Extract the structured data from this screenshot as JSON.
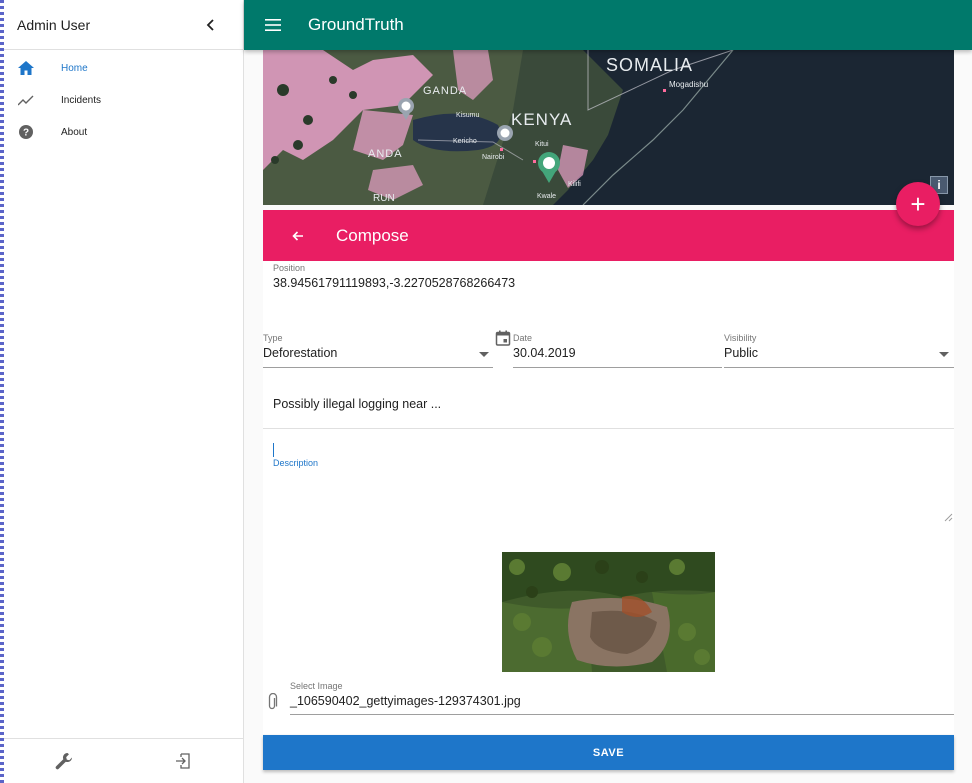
{
  "sidebar": {
    "user_name": "Admin User",
    "items": [
      {
        "label": "Home",
        "icon": "home-icon",
        "active": true
      },
      {
        "label": "Incidents",
        "icon": "trending-icon",
        "active": false
      },
      {
        "label": "About",
        "icon": "help-icon",
        "active": false
      }
    ]
  },
  "appbar": {
    "title": "GroundTruth"
  },
  "map": {
    "labels": {
      "somalia": "SOMALIA",
      "kenya": "KENYA",
      "mogadishu": "Mogadishu",
      "ganda": "GANDA",
      "anda": "ANDA",
      "kitui": "Kitui",
      "nairobi": "Nairobi",
      "kericho": "Kericho",
      "kisumu": "Kisumu",
      "kilifi": "Kilifi",
      "kwale": "Kwale",
      "run": "RUN"
    },
    "info_label": "i"
  },
  "compose": {
    "title": "Compose",
    "position": {
      "label": "Position",
      "value": "38.94561791119893,-3.2270528768266473"
    },
    "type": {
      "label": "Type",
      "value": "Deforestation"
    },
    "date": {
      "label": "Date",
      "value": "30.04.2019"
    },
    "visibility": {
      "label": "Visibility",
      "value": "Public"
    },
    "title_field": {
      "value": "Possibly illegal logging near ..."
    },
    "description": {
      "label": "Description",
      "value": ""
    },
    "image": {
      "label": "Select Image",
      "value": "_106590402_gettyimages-129374301.jpg"
    },
    "save_label": "SAVE"
  },
  "fab_label": "+",
  "colors": {
    "appbar": "#00796b",
    "accent": "#e91e63",
    "primary": "#1e76c9"
  }
}
